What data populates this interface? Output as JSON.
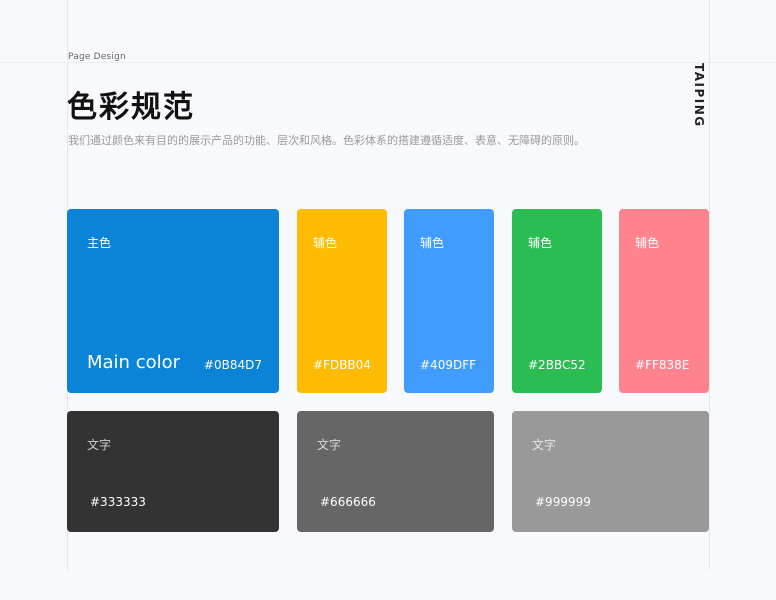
{
  "header": {
    "kicker": "Page Design",
    "title": "色彩规范",
    "description": "我们通过颜色来有目的的展示产品的功能、层次和风格。色彩体系的搭建遵循适度、表意、无障碍的原则。",
    "brand": "TAIPING"
  },
  "main_color": {
    "label": "主色",
    "name": "Main color",
    "hex": "#0B84D7",
    "color": "#0B84D7"
  },
  "accents": [
    {
      "label": "辅色",
      "hex": "#FDBB04",
      "color": "#FDBB04"
    },
    {
      "label": "辅色",
      "hex": "#409DFF",
      "color": "#409DFF"
    },
    {
      "label": "辅色",
      "hex": "#2BBC52",
      "color": "#2BBC52"
    },
    {
      "label": "辅色",
      "hex": "#FF838E",
      "color": "#FF838E"
    }
  ],
  "text_colors": [
    {
      "label": "文字",
      "hex": "#333333",
      "color": "#333333"
    },
    {
      "label": "文字",
      "hex": "#666666",
      "color": "#666666"
    },
    {
      "label": "文字",
      "hex": "#999999",
      "color": "#999999"
    }
  ]
}
